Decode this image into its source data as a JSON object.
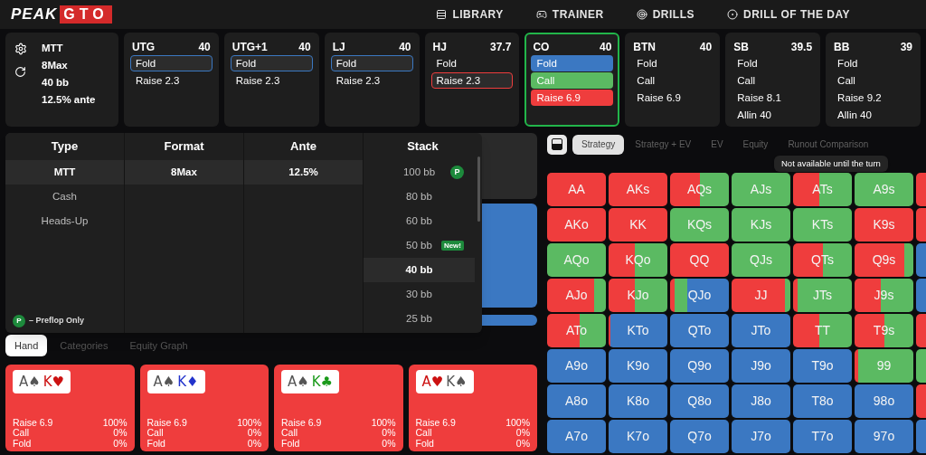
{
  "logo": {
    "text": "PEAK",
    "highlight": "GTO"
  },
  "nav": [
    {
      "label": "LIBRARY"
    },
    {
      "label": "TRAINER"
    },
    {
      "label": "DRILLS"
    },
    {
      "label": "DRILL OF THE DAY"
    }
  ],
  "settings": {
    "lines": [
      "MTT",
      "8Max",
      "40 bb",
      "12.5% ante"
    ]
  },
  "positions": [
    {
      "name": "UTG",
      "stack": "40",
      "active": false,
      "actions": [
        {
          "label": "Fold",
          "kind": "fold",
          "selected": true
        },
        {
          "label": "Raise 2.3",
          "kind": "raise",
          "selected": false
        }
      ]
    },
    {
      "name": "UTG+1",
      "stack": "40",
      "active": false,
      "actions": [
        {
          "label": "Fold",
          "kind": "fold",
          "selected": true
        },
        {
          "label": "Raise 2.3",
          "kind": "raise",
          "selected": false
        }
      ]
    },
    {
      "name": "LJ",
      "stack": "40",
      "active": false,
      "actions": [
        {
          "label": "Fold",
          "kind": "fold",
          "selected": true
        },
        {
          "label": "Raise 2.3",
          "kind": "raise",
          "selected": false
        }
      ]
    },
    {
      "name": "HJ",
      "stack": "37.7",
      "active": false,
      "actions": [
        {
          "label": "Fold",
          "kind": "fold",
          "selected": false
        },
        {
          "label": "Raise 2.3",
          "kind": "raise",
          "selected": true
        }
      ]
    },
    {
      "name": "CO",
      "stack": "40",
      "active": true,
      "actions": [
        {
          "label": "Fold",
          "kind": "fold",
          "selected": false
        },
        {
          "label": "Call",
          "kind": "call",
          "selected": false
        },
        {
          "label": "Raise 6.9",
          "kind": "raise",
          "selected": false
        }
      ]
    },
    {
      "name": "BTN",
      "stack": "40",
      "active": false,
      "actions": [
        {
          "label": "Fold",
          "kind": "fold",
          "selected": false
        },
        {
          "label": "Call",
          "kind": "call",
          "selected": false
        },
        {
          "label": "Raise 6.9",
          "kind": "raise",
          "selected": false
        }
      ]
    },
    {
      "name": "SB",
      "stack": "39.5",
      "active": false,
      "actions": [
        {
          "label": "Fold",
          "kind": "fold",
          "selected": false
        },
        {
          "label": "Call",
          "kind": "call",
          "selected": false
        },
        {
          "label": "Raise 8.1",
          "kind": "raise",
          "selected": false
        },
        {
          "label": "Allin 40",
          "kind": "allin",
          "selected": false
        }
      ]
    },
    {
      "name": "BB",
      "stack": "39",
      "active": false,
      "actions": [
        {
          "label": "Fold",
          "kind": "fold",
          "selected": false
        },
        {
          "label": "Call",
          "kind": "call",
          "selected": false
        },
        {
          "label": "Raise 9.2",
          "kind": "raise",
          "selected": false
        },
        {
          "label": "Allin 40",
          "kind": "allin",
          "selected": false
        }
      ]
    }
  ],
  "game_menu": {
    "columns": [
      {
        "title": "Type",
        "options": [
          {
            "label": "MTT",
            "selected": true
          },
          {
            "label": "Cash",
            "selected": false
          },
          {
            "label": "Heads-Up",
            "selected": false
          }
        ]
      },
      {
        "title": "Format",
        "options": [
          {
            "label": "8Max",
            "selected": true
          }
        ]
      },
      {
        "title": "Ante",
        "options": [
          {
            "label": "12.5%",
            "selected": true
          }
        ]
      },
      {
        "title": "Stack",
        "options": [
          {
            "label": "100 bb",
            "selected": false,
            "badge": {
              "kind": "circle",
              "text": "P"
            }
          },
          {
            "label": "80 bb",
            "selected": false
          },
          {
            "label": "60 bb",
            "selected": false
          },
          {
            "label": "50 bb",
            "selected": false,
            "badge": {
              "kind": "tag",
              "text": "New!"
            }
          },
          {
            "label": "40 bb",
            "selected": true
          },
          {
            "label": "30 bb",
            "selected": false
          },
          {
            "label": "25 bb",
            "selected": false
          }
        ]
      }
    ],
    "legend": {
      "badge": "P",
      "text": "– Preflop Only"
    }
  },
  "hand_tabs": [
    {
      "label": "Hand",
      "selected": true
    },
    {
      "label": "Categories",
      "selected": false
    },
    {
      "label": "Equity Graph",
      "selected": false
    }
  ],
  "combos": [
    {
      "kind": "raise",
      "cards": [
        {
          "rank": "A",
          "suit": "♠",
          "color": "#555555"
        },
        {
          "rank": "K",
          "suit": "♥",
          "color": "#cc1111"
        }
      ],
      "stats": [
        {
          "label": "Raise 6.9",
          "value": "100%"
        },
        {
          "label": "Call",
          "value": "0%"
        },
        {
          "label": "Fold",
          "value": "0%"
        }
      ]
    },
    {
      "kind": "raise",
      "cards": [
        {
          "rank": "A",
          "suit": "♠",
          "color": "#555555"
        },
        {
          "rank": "K",
          "suit": "♦",
          "color": "#2233cc"
        }
      ],
      "stats": [
        {
          "label": "Raise 6.9",
          "value": "100%"
        },
        {
          "label": "Call",
          "value": "0%"
        },
        {
          "label": "Fold",
          "value": "0%"
        }
      ]
    },
    {
      "kind": "raise",
      "cards": [
        {
          "rank": "A",
          "suit": "♠",
          "color": "#555555"
        },
        {
          "rank": "K",
          "suit": "♣",
          "color": "#1a9a1a"
        }
      ],
      "stats": [
        {
          "label": "Raise 6.9",
          "value": "100%"
        },
        {
          "label": "Call",
          "value": "0%"
        },
        {
          "label": "Fold",
          "value": "0%"
        }
      ]
    },
    {
      "kind": "raise",
      "cards": [
        {
          "rank": "A",
          "suit": "♥",
          "color": "#cc1111"
        },
        {
          "rank": "K",
          "suit": "♠",
          "color": "#555555"
        }
      ],
      "stats": [
        {
          "label": "Raise 6.9",
          "value": "100%"
        },
        {
          "label": "Call",
          "value": "0%"
        },
        {
          "label": "Fold",
          "value": "0%"
        }
      ]
    }
  ],
  "view_tabs": [
    {
      "label": "Strategy",
      "selected": true
    },
    {
      "label": "Strategy + EV",
      "selected": false
    },
    {
      "label": "EV",
      "selected": false
    },
    {
      "label": "Equity",
      "selected": false
    },
    {
      "label": "Runout Comparison",
      "selected": false
    }
  ],
  "tooltip": "Not available until the turn",
  "hands": [
    {
      "label": "AA",
      "mix": [
        {
          "kind": "raise",
          "level": 1
        }
      ]
    },
    {
      "label": "AKs",
      "mix": [
        {
          "kind": "raise",
          "level": 1
        }
      ]
    },
    {
      "label": "AQs",
      "mix": [
        {
          "kind": "raise",
          "level": 0.5
        },
        {
          "kind": "call",
          "level": 0.5
        }
      ]
    },
    {
      "label": "AJs",
      "mix": [
        {
          "kind": "call",
          "level": 1
        }
      ]
    },
    {
      "label": "ATs",
      "mix": [
        {
          "kind": "raise",
          "level": 0.45
        },
        {
          "kind": "call",
          "level": 0.55
        }
      ]
    },
    {
      "label": "A9s",
      "mix": [
        {
          "kind": "call",
          "level": 1
        }
      ]
    },
    {
      "mix": [
        {
          "kind": "raise",
          "level": 1
        }
      ]
    },
    {
      "label": "AKo",
      "mix": [
        {
          "kind": "raise",
          "level": 1
        }
      ]
    },
    {
      "label": "KK",
      "mix": [
        {
          "kind": "raise",
          "level": 1
        }
      ]
    },
    {
      "label": "KQs",
      "mix": [
        {
          "kind": "call",
          "level": 1
        }
      ]
    },
    {
      "label": "KJs",
      "mix": [
        {
          "kind": "call",
          "level": 1
        }
      ]
    },
    {
      "label": "KTs",
      "mix": [
        {
          "kind": "call",
          "level": 1
        }
      ]
    },
    {
      "label": "K9s",
      "mix": [
        {
          "kind": "raise",
          "level": 1
        }
      ]
    },
    {
      "mix": [
        {
          "kind": "raise",
          "level": 1
        }
      ]
    },
    {
      "label": "AQo",
      "mix": [
        {
          "kind": "call",
          "level": 1
        }
      ]
    },
    {
      "label": "KQo",
      "mix": [
        {
          "kind": "raise",
          "level": 0.45
        },
        {
          "kind": "call",
          "level": 0.55
        }
      ]
    },
    {
      "label": "QQ",
      "mix": [
        {
          "kind": "raise",
          "level": 1
        }
      ]
    },
    {
      "label": "QJs",
      "mix": [
        {
          "kind": "call",
          "level": 1
        }
      ]
    },
    {
      "label": "QTs",
      "mix": [
        {
          "kind": "raise",
          "level": 0.5
        },
        {
          "kind": "call",
          "level": 0.5
        }
      ]
    },
    {
      "label": "Q9s",
      "mix": [
        {
          "kind": "raise",
          "level": 0.85
        },
        {
          "kind": "call",
          "level": 0.15
        }
      ]
    },
    {
      "mix": [
        {
          "kind": "fold",
          "level": 1
        }
      ]
    },
    {
      "label": "AJo",
      "mix": [
        {
          "kind": "raise",
          "level": 0.8
        },
        {
          "kind": "call",
          "level": 0.2
        }
      ]
    },
    {
      "label": "KJo",
      "mix": [
        {
          "kind": "raise",
          "level": 0.45
        },
        {
          "kind": "call",
          "level": 0.55
        }
      ]
    },
    {
      "label": "QJo",
      "mix": [
        {
          "kind": "raise",
          "level": 0.08
        },
        {
          "kind": "call",
          "level": 0.22
        },
        {
          "kind": "fold",
          "level": 0.7
        }
      ]
    },
    {
      "label": "JJ",
      "mix": [
        {
          "kind": "raise",
          "level": 0.9
        },
        {
          "kind": "call",
          "level": 0.1
        }
      ]
    },
    {
      "label": "JTs",
      "mix": [
        {
          "kind": "raise",
          "level": 0.08
        },
        {
          "kind": "call",
          "level": 0.92
        }
      ]
    },
    {
      "label": "J9s",
      "mix": [
        {
          "kind": "raise",
          "level": 0.45
        },
        {
          "kind": "call",
          "level": 0.55
        }
      ]
    },
    {
      "mix": [
        {
          "kind": "fold",
          "level": 1
        }
      ]
    },
    {
      "label": "ATo",
      "mix": [
        {
          "kind": "raise",
          "level": 0.55
        },
        {
          "kind": "call",
          "level": 0.45
        }
      ]
    },
    {
      "label": "KTo",
      "mix": [
        {
          "kind": "raise",
          "level": 0.03
        },
        {
          "kind": "fold",
          "level": 0.97
        }
      ]
    },
    {
      "label": "QTo",
      "mix": [
        {
          "kind": "fold",
          "level": 1
        }
      ]
    },
    {
      "label": "JTo",
      "mix": [
        {
          "kind": "fold",
          "level": 1
        }
      ]
    },
    {
      "label": "TT",
      "mix": [
        {
          "kind": "raise",
          "level": 0.45
        },
        {
          "kind": "call",
          "level": 0.55
        }
      ]
    },
    {
      "label": "T9s",
      "mix": [
        {
          "kind": "raise",
          "level": 0.5
        },
        {
          "kind": "call",
          "level": 0.5
        }
      ]
    },
    {
      "mix": [
        {
          "kind": "raise",
          "level": 1
        }
      ]
    },
    {
      "label": "A9o",
      "mix": [
        {
          "kind": "fold",
          "level": 1
        }
      ]
    },
    {
      "label": "K9o",
      "mix": [
        {
          "kind": "fold",
          "level": 1
        }
      ]
    },
    {
      "label": "Q9o",
      "mix": [
        {
          "kind": "fold",
          "level": 1
        }
      ]
    },
    {
      "label": "J9o",
      "mix": [
        {
          "kind": "fold",
          "level": 1
        }
      ]
    },
    {
      "label": "T9o",
      "mix": [
        {
          "kind": "fold",
          "level": 1
        }
      ]
    },
    {
      "label": "99",
      "mix": [
        {
          "kind": "raise",
          "level": 0.06
        },
        {
          "kind": "call",
          "level": 0.94
        }
      ]
    },
    {
      "mix": [
        {
          "kind": "call",
          "level": 1
        }
      ]
    },
    {
      "label": "A8o",
      "mix": [
        {
          "kind": "fold",
          "level": 1
        }
      ]
    },
    {
      "label": "K8o",
      "mix": [
        {
          "kind": "fold",
          "level": 1
        }
      ]
    },
    {
      "label": "Q8o",
      "mix": [
        {
          "kind": "fold",
          "level": 1
        }
      ]
    },
    {
      "label": "J8o",
      "mix": [
        {
          "kind": "fold",
          "level": 1
        }
      ]
    },
    {
      "label": "T8o",
      "mix": [
        {
          "kind": "fold",
          "level": 1
        }
      ]
    },
    {
      "label": "98o",
      "mix": [
        {
          "kind": "fold",
          "level": 1
        }
      ]
    },
    {
      "mix": [
        {
          "kind": "raise",
          "level": 1
        }
      ]
    },
    {
      "label": "A7o",
      "mix": [
        {
          "kind": "fold",
          "level": 1
        }
      ]
    },
    {
      "label": "K7o",
      "mix": [
        {
          "kind": "fold",
          "level": 1
        }
      ]
    },
    {
      "label": "Q7o",
      "mix": [
        {
          "kind": "fold",
          "level": 1
        }
      ]
    },
    {
      "label": "J7o",
      "mix": [
        {
          "kind": "fold",
          "level": 1
        }
      ]
    },
    {
      "label": "T7o",
      "mix": [
        {
          "kind": "fold",
          "level": 1
        }
      ]
    },
    {
      "label": "97o",
      "mix": [
        {
          "kind": "fold",
          "level": 1
        }
      ]
    },
    {
      "mix": [
        {
          "kind": "fold",
          "level": 1
        }
      ]
    }
  ]
}
